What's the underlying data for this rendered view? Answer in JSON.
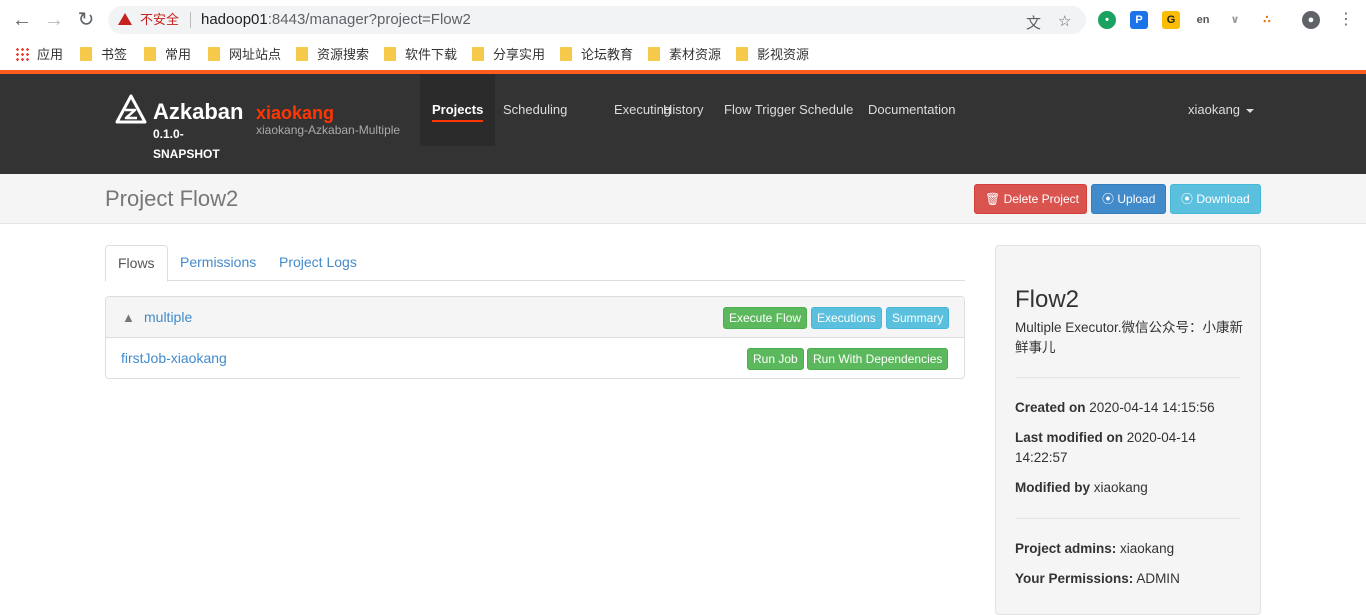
{
  "browser": {
    "security_label": "不安全",
    "url_host": "hadoop01",
    "url_rest": ":8443/manager?project=Flow2",
    "bookmarks": [
      "应用",
      "书签",
      "常用",
      "网址站点",
      "资源搜索",
      "软件下载",
      "分享实用",
      "论坛教育",
      "素材资源",
      "影视资源"
    ]
  },
  "header": {
    "brand": "Azkaban",
    "version": "0.1.0-SNAPSHOT",
    "user": "xiaokang",
    "subtitle": "xiaokang-Azkaban-Multiple",
    "nav": [
      "Projects",
      "Scheduling",
      "Executing",
      "History",
      "Flow Trigger Schedule",
      "Documentation"
    ],
    "active_nav": "Projects",
    "user_menu": "xiaokang"
  },
  "project": {
    "title": "Project Flow2",
    "delete_label": "Delete Project",
    "upload_label": "Upload",
    "download_label": "Download"
  },
  "tabs": [
    "Flows",
    "Permissions",
    "Project Logs"
  ],
  "flow": {
    "name": "multiple",
    "execute_label": "Execute Flow",
    "executions_label": "Executions",
    "summary_label": "Summary",
    "job": {
      "name": "firstJob-xiaokang",
      "run_label": "Run Job",
      "run_deps_label": "Run With Dependencies"
    }
  },
  "sidebar": {
    "name": "Flow2",
    "description": "Multiple Executor.微信公众号：小康新鲜事儿",
    "created_label": "Created on",
    "created_value": "2020-04-14 14:15:56",
    "modified_label": "Last modified on",
    "modified_value": "2020-04-14 14:22:57",
    "modified_by_label": "Modified by",
    "modified_by_value": "xiaokang",
    "admins_label": "Project admins:",
    "admins_value": "xiaokang",
    "permissions_label": "Your Permissions:",
    "permissions_value": "ADMIN"
  },
  "colors": {
    "accent": "#ff3601",
    "header_bg": "#333333",
    "danger": "#d9534f",
    "primary": "#428bca",
    "info": "#5bc0de",
    "success": "#5cb85c"
  }
}
